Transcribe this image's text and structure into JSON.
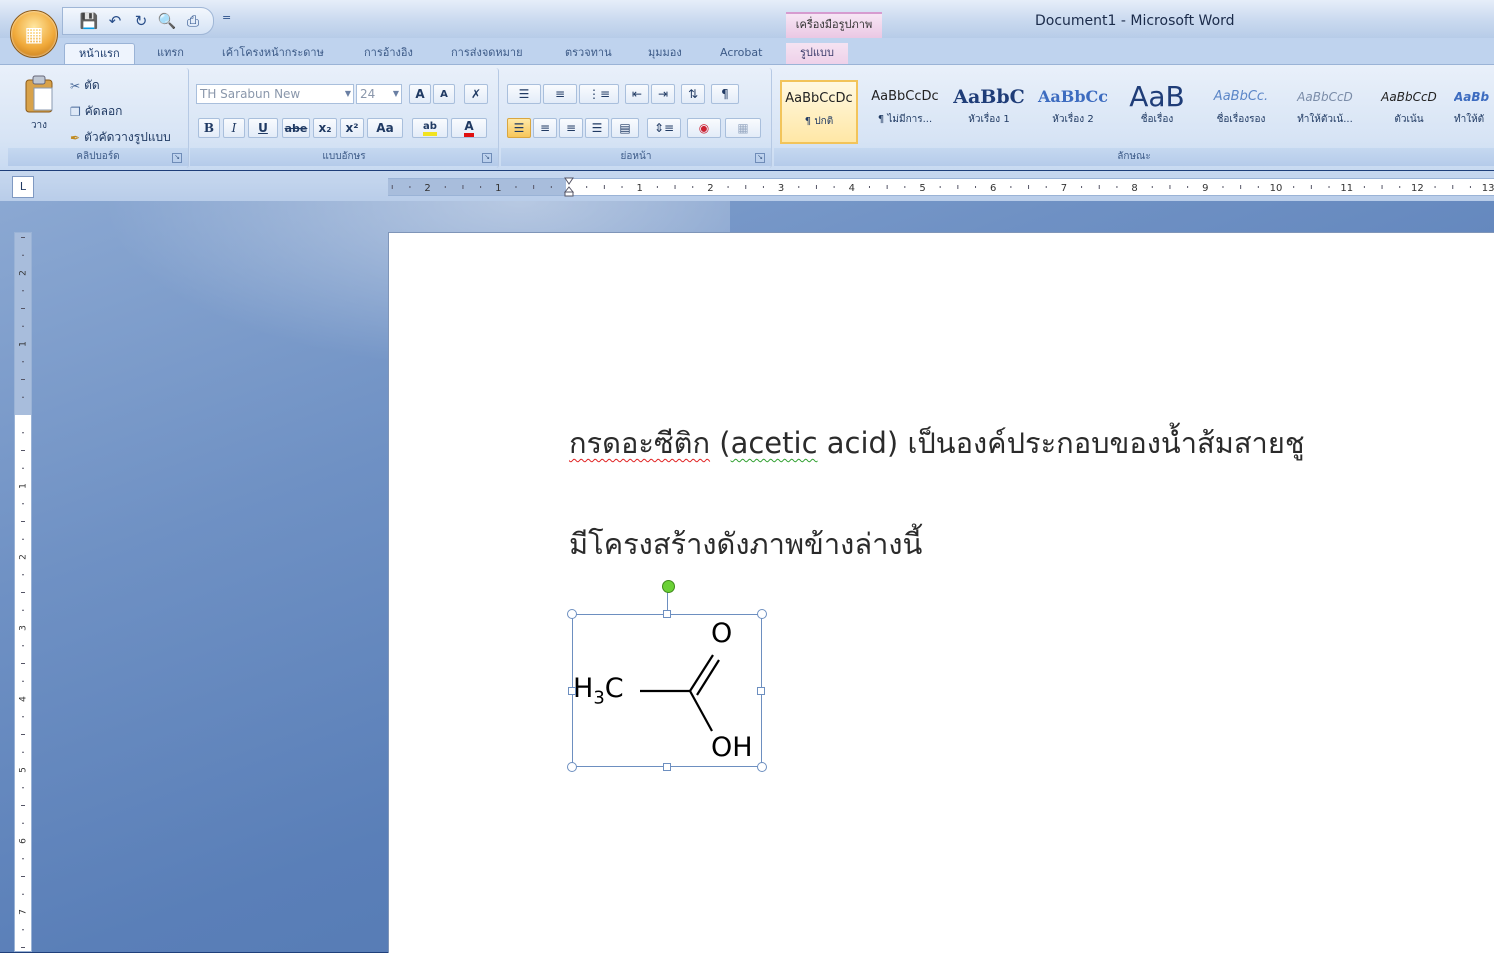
{
  "window": {
    "title": "Document1 - Microsoft Word",
    "contextual_group": "เครื่องมือรูปภาพ"
  },
  "quick_access": {
    "customize": "="
  },
  "tabs": [
    {
      "label": "หน้าแรก",
      "active": true
    },
    {
      "label": "แทรก"
    },
    {
      "label": "เค้าโครงหน้ากระดาษ"
    },
    {
      "label": "การอ้างอิง"
    },
    {
      "label": "การส่งจดหมาย"
    },
    {
      "label": "ตรวจทาน"
    },
    {
      "label": "มุมมอง"
    },
    {
      "label": "Acrobat"
    },
    {
      "label": "รูปแบบ",
      "contextual": true
    }
  ],
  "clipboard": {
    "paste": "วาง",
    "cut": "ตัด",
    "copy": "คัดลอก",
    "format_painter": "ตัวคัดวางรูปแบบ",
    "label": "คลิปบอร์ด"
  },
  "font": {
    "name": "TH Sarabun New",
    "size": "24",
    "label": "แบบอักษร",
    "buttons": [
      "B",
      "I",
      "U",
      "abe",
      "x₂",
      "x²",
      "Aa"
    ]
  },
  "paragraph": {
    "label": "ย่อหน้า"
  },
  "styles": {
    "label": "ลักษณะ",
    "items": [
      {
        "sample": "AaBbCcDc",
        "name": "¶ ปกติ",
        "selected": true
      },
      {
        "sample": "AaBbCcDc",
        "name": "¶ ไม่มีการ..."
      },
      {
        "sample": "AaBbC",
        "name": "หัวเรื่อง 1"
      },
      {
        "sample": "AaBbCc",
        "name": "หัวเรื่อง 2"
      },
      {
        "sample": "AaB",
        "name": "ชื่อเรื่อง"
      },
      {
        "sample": "AaBbCc.",
        "name": "ชื่อเรื่องรอง"
      },
      {
        "sample": "AaBbCcD",
        "name": "ทำให้ตัวเน้..."
      },
      {
        "sample": "AaBbCcD",
        "name": "ตัวเน้น"
      },
      {
        "sample": "AaBb",
        "name": "ทำให้ตั"
      }
    ]
  },
  "ruler": {
    "labels": [
      "2",
      "1",
      "1",
      "2",
      "3",
      "4",
      "5",
      "6",
      "7",
      "8",
      "9",
      "10",
      "11",
      "12",
      "13"
    ],
    "vertical_labels": [
      "2",
      "1",
      "1",
      "2",
      "3",
      "4",
      "5",
      "6",
      "7"
    ],
    "tab_selector": "L"
  },
  "document": {
    "line1_part1": "กรดอะซีติก",
    "line1_part2": "(",
    "line1_part3": "acetic",
    "line1_part4": "acid) เป็นองค์ประกอบของน้ำส้มสายชู",
    "line2": "มีโครงสร้างดังภาพข้างล่างนี้",
    "molecule": {
      "left_group": "H",
      "subscript": "3",
      "carbon": "C",
      "carbonyl": "O",
      "hydroxyl": "OH"
    }
  }
}
